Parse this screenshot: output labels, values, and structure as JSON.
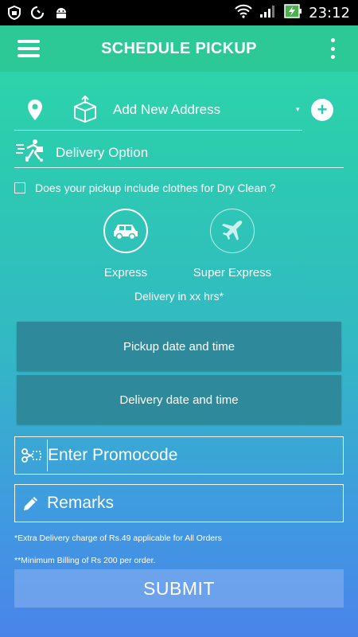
{
  "status_bar": {
    "time": "23:12",
    "icons": [
      "shield-icon",
      "sync-icon",
      "android-icon",
      "wifi-icon",
      "signal-icon",
      "battery-charging-icon"
    ]
  },
  "app_bar": {
    "title": "SCHEDULE PICKUP"
  },
  "address": {
    "placeholder": "Add New Address",
    "add_symbol": "+",
    "dropdown_symbol": "▾"
  },
  "delivery": {
    "label": "Delivery Option"
  },
  "dry_clean": {
    "question": "Does your pickup include clothes for Dry Clean ?",
    "checked": false
  },
  "options": [
    {
      "label": "Express",
      "icon": "car-icon",
      "selected": true
    },
    {
      "label": "Super Express",
      "icon": "airplane-icon",
      "selected": false
    }
  ],
  "delivery_time_text": "Delivery in xx hrs*",
  "buttons": {
    "pickup_datetime": "Pickup date and time",
    "delivery_datetime": "Delivery date and time",
    "submit": "SUBMIT"
  },
  "promo": {
    "placeholder": "Enter Promocode"
  },
  "remarks": {
    "placeholder": "Remarks"
  },
  "notes": {
    "extra_charge": "*Extra Delivery charge of Rs.49 applicable for All Orders",
    "min_billing": "**Minimum Billing of Rs 200 per order."
  },
  "colors": {
    "gradient_top": "#2fd9a6",
    "gradient_bottom": "#4a84ea",
    "app_bar": "#2cc996",
    "date_button": "#2e8a9a"
  }
}
